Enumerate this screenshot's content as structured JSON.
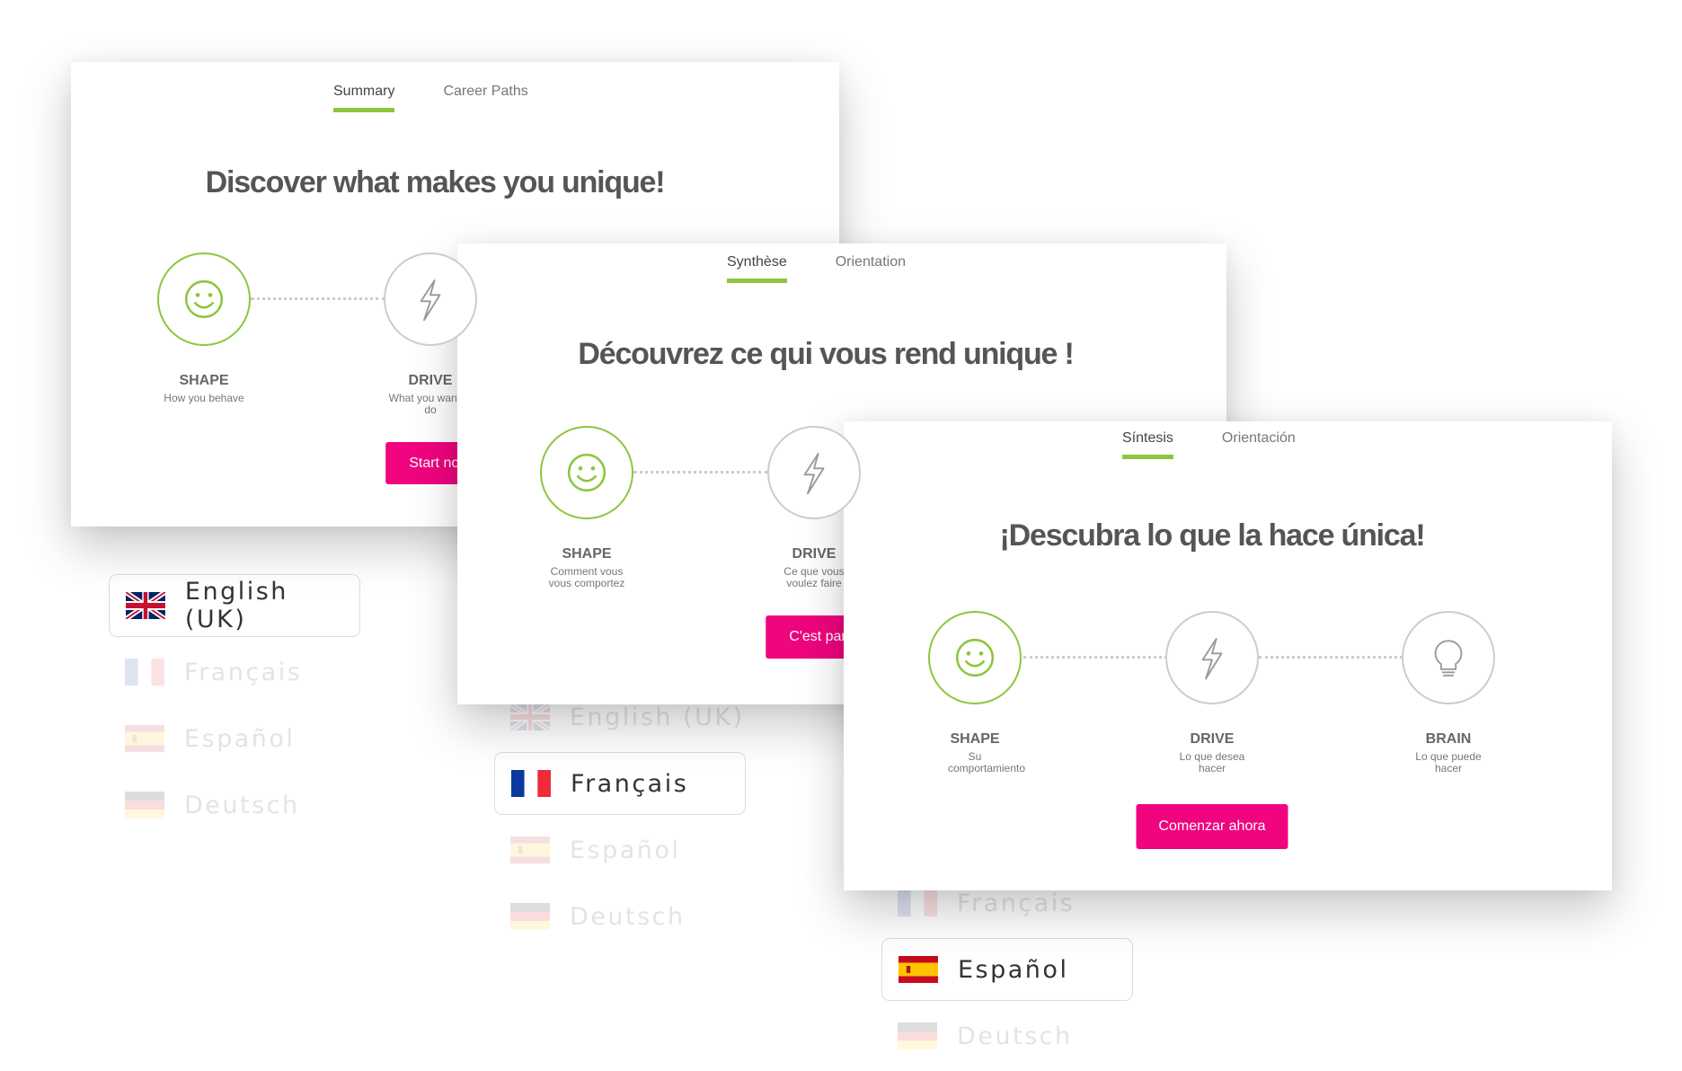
{
  "cards": [
    {
      "tabs": [
        "Summary",
        "Career Paths"
      ],
      "title": "Discover what makes you unique!",
      "steps": [
        {
          "label": "SHAPE",
          "sub": "How you behave"
        },
        {
          "label": "DRIVE",
          "sub": "What you want to do"
        }
      ],
      "button": "Start now"
    },
    {
      "tabs": [
        "Synthèse",
        "Orientation"
      ],
      "title": "Découvrez ce qui vous rend unique !",
      "steps": [
        {
          "label": "SHAPE",
          "sub": "Comment vous vous comportez"
        },
        {
          "label": "DRIVE",
          "sub": "Ce que vous voulez faire"
        }
      ],
      "button": "C'est parti"
    },
    {
      "tabs": [
        "Síntesis",
        "Orientación"
      ],
      "title": "¡Descubra lo que la hace única!",
      "steps": [
        {
          "label": "SHAPE",
          "sub": "Su comportamiento"
        },
        {
          "label": "DRIVE",
          "sub": "Lo que desea hacer"
        },
        {
          "label": "BRAIN",
          "sub": "Lo que puede hacer"
        }
      ],
      "button": "Comenzar ahora"
    }
  ],
  "language_lists": [
    {
      "selected": "English (UK)",
      "items": [
        "English (UK)",
        "Français",
        "Español",
        "Deutsch"
      ]
    },
    {
      "selected": "Français",
      "items": [
        "English (UK)",
        "Français",
        "Español",
        "Deutsch"
      ]
    },
    {
      "selected": "Español",
      "items": [
        "Français",
        "Español",
        "Deutsch"
      ]
    }
  ],
  "colors": {
    "accent_green": "#8cc63f",
    "button_pink": "#f0047f",
    "title_gray": "#555555"
  },
  "icons": {
    "shape": "smiley-icon",
    "drive": "lightning-bolt-icon",
    "brain": "lightbulb-icon"
  }
}
